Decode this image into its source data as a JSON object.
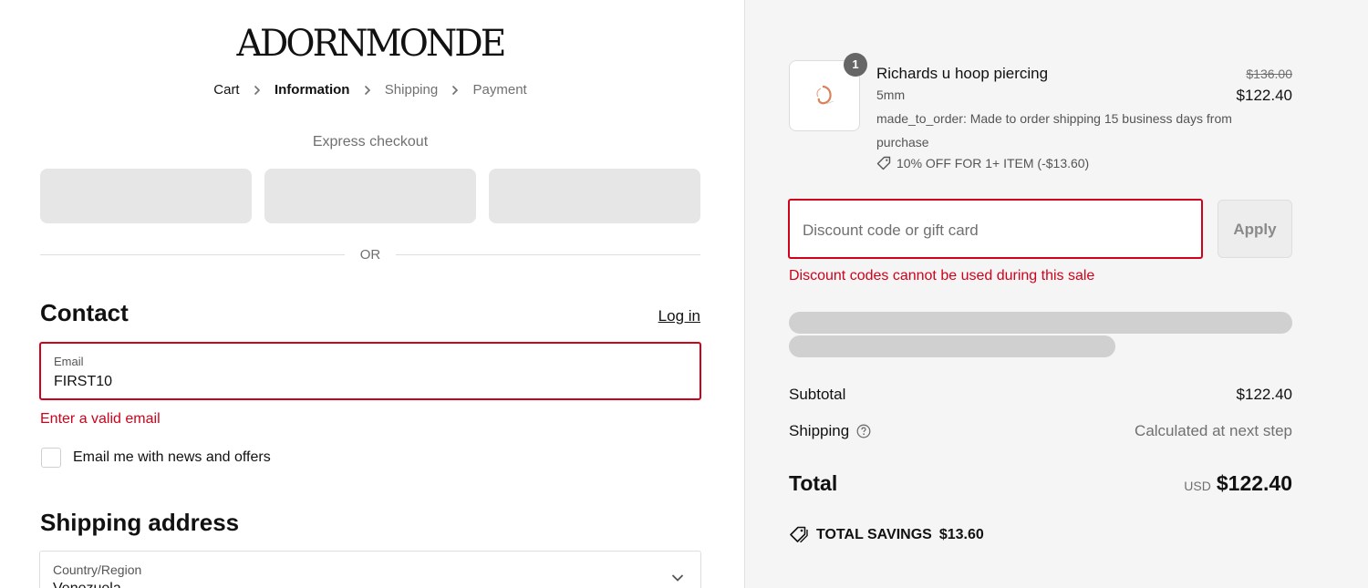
{
  "brand": {
    "logo_text": "ADORNMONDE"
  },
  "breadcrumb": {
    "cart": "Cart",
    "information": "Information",
    "shipping": "Shipping",
    "payment": "Payment"
  },
  "express": {
    "title": "Express checkout"
  },
  "divider": {
    "or": "OR"
  },
  "contact": {
    "title": "Contact",
    "login": "Log in",
    "email_label": "Email",
    "email_value": "FIRST10",
    "email_error": "Enter a valid email",
    "newsletter_label": "Email me with news and offers"
  },
  "shipping_address": {
    "title": "Shipping address",
    "country_label": "Country/Region",
    "country_value": "Venezuela"
  },
  "order": {
    "quantity": "1",
    "product_name": "Richards u hoop piercing",
    "variant": "5mm",
    "note": "made_to_order: Made to order shipping 15 business days from purchase",
    "discount_line": "10% OFF FOR 1+ ITEM (-$13.60)",
    "price_original": "$136.00",
    "price_current": "$122.40"
  },
  "discount": {
    "placeholder": "Discount code or gift card",
    "apply": "Apply",
    "error": "Discount codes cannot be used during this sale"
  },
  "summary": {
    "subtotal_label": "Subtotal",
    "subtotal_value": "$122.40",
    "shipping_label": "Shipping",
    "shipping_value": "Calculated at next step",
    "total_label": "Total",
    "currency": "USD",
    "total_value": "$122.40",
    "savings_label": "TOTAL SAVINGS",
    "savings_value": "$13.60"
  },
  "colors": {
    "error": "#d0021b",
    "panel_bg": "#f5f5f5",
    "skeleton": "#d0d0d0"
  },
  "icons": [
    "chevron-right-icon",
    "tag-icon",
    "help-icon",
    "chevron-down-icon",
    "product-image"
  ]
}
